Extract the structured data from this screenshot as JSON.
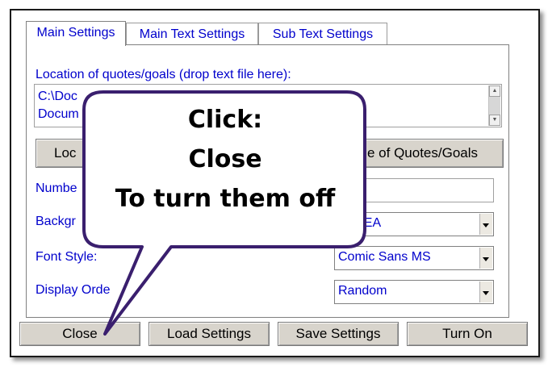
{
  "tabs": [
    {
      "label": "Main Settings",
      "active": true
    },
    {
      "label": "Main Text Settings",
      "active": false
    },
    {
      "label": "Sub Text Settings",
      "active": false
    }
  ],
  "location": {
    "label": "Location of quotes/goals (drop text file here):",
    "lines": [
      "C:\\Doc",
      "Docum"
    ]
  },
  "buttons_row": {
    "left_label": "Loc",
    "right_label": "e of Quotes/Goals"
  },
  "fields": {
    "number_label": "Numbe",
    "background_label": "Backgr",
    "background_value": "FEA",
    "font_style_label": "Font Style:",
    "font_style_value": "Comic Sans MS",
    "display_order_label": "Display Orde",
    "display_order_value": "Random"
  },
  "bottom_buttons": {
    "close": "Close",
    "load": "Load Settings",
    "save": "Save Settings",
    "turn_on": "Turn On"
  },
  "callout": {
    "line1": "Click:",
    "line2": "Close",
    "line3": "To turn them off"
  },
  "colors": {
    "accent_text": "#0000cc",
    "callout_border": "#3a1f6e",
    "button_face": "#d8d4cc"
  }
}
